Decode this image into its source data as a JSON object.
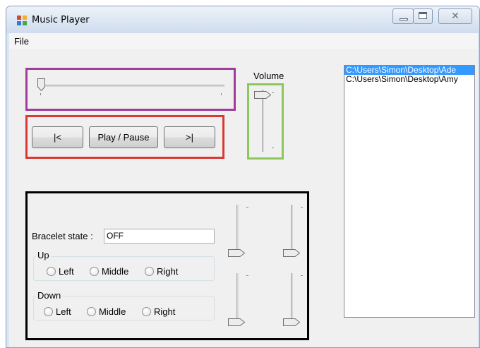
{
  "window": {
    "title": "Music Player"
  },
  "menu": {
    "file": "File"
  },
  "transport": {
    "prev_label": "|<",
    "play_label": "Play / Pause",
    "next_label": ">|"
  },
  "volume": {
    "label": "Volume"
  },
  "playlist": {
    "items": [
      {
        "path": "C:\\Users\\Simon\\Desktop\\Ade",
        "selected": true
      },
      {
        "path": "C:\\Users\\Simon\\Desktop\\Amy",
        "selected": false
      }
    ]
  },
  "bracelet": {
    "state_label": "Bracelet state :",
    "state_value": "OFF",
    "up": {
      "title": "Up",
      "options": [
        "Left",
        "Middle",
        "Right"
      ]
    },
    "down": {
      "title": "Down",
      "options": [
        "Left",
        "Middle",
        "Right"
      ]
    }
  },
  "colors": {
    "highlight_purple": "#a23d9b",
    "highlight_red": "#db3a34",
    "highlight_green": "#8cc85a",
    "highlight_black": "#000000",
    "selection": "#3399ff"
  },
  "icons": [
    "app-icon",
    "minimize-icon",
    "maximize-icon",
    "close-icon"
  ]
}
